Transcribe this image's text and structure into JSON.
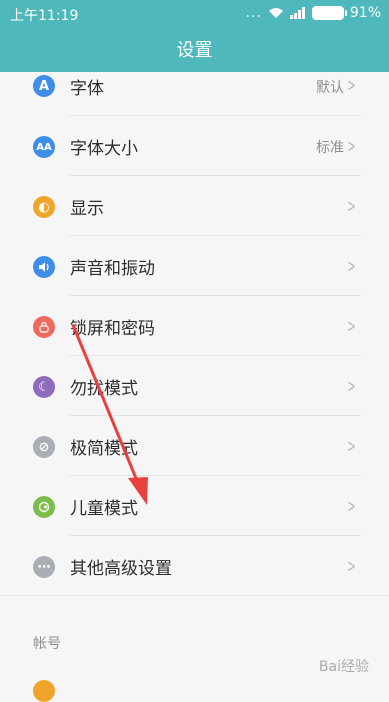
{
  "status": {
    "time": "上午11:19",
    "dots": "...",
    "battery": "91%"
  },
  "header": {
    "title": "设置"
  },
  "items": [
    {
      "label": "字体",
      "value": "默认",
      "icon_char": "A",
      "color": "#3e8de8",
      "icon": "font-icon"
    },
    {
      "label": "字体大小",
      "value": "标准",
      "icon_char": "AA",
      "color": "#3e8de8",
      "icon": "font-size-icon"
    },
    {
      "label": "显示",
      "value": "",
      "icon_char": "◐",
      "color": "#f0a52a",
      "icon": "display-icon"
    },
    {
      "label": "声音和振动",
      "value": "",
      "icon_char": "🔊",
      "color": "#3e8de8",
      "icon": "sound-icon"
    },
    {
      "label": "锁屏和密码",
      "value": "",
      "icon_char": "⊖",
      "color": "#ef6a5b",
      "icon": "lock-icon"
    },
    {
      "label": "勿扰模式",
      "value": "",
      "icon_char": "☾",
      "color": "#8e6bbd",
      "icon": "moon-icon"
    },
    {
      "label": "极简模式",
      "value": "",
      "icon_char": "⊘",
      "color": "#a8aeb4",
      "icon": "minimal-icon"
    },
    {
      "label": "儿童模式",
      "value": "",
      "icon_char": "◑",
      "color": "#7cbd4c",
      "icon": "child-icon"
    },
    {
      "label": "其他高级设置",
      "value": "",
      "icon_char": "⋯",
      "color": "#a8aeb4",
      "icon": "more-icon"
    }
  ],
  "section": {
    "title": "帐号"
  },
  "watermark": "Bai经验"
}
